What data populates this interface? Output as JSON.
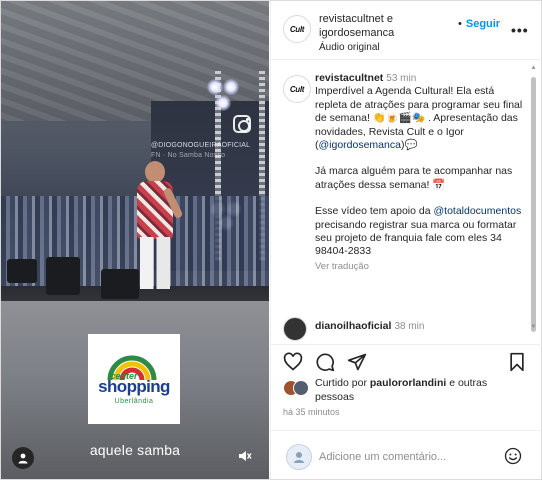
{
  "video": {
    "watermark_line1": "@DIOGONOGUEIRAOFICIAL",
    "watermark_line2": "FN · No Samba Nosso",
    "logo": {
      "center": "center",
      "shopping": "shopping",
      "city": "Uberlândia"
    },
    "caption": "aquele samba"
  },
  "header": {
    "usernames_line1": "revistacultnet e",
    "usernames_line2": "igordosemanca",
    "audio": "Áudio original",
    "follow_separator": "•",
    "follow_label": "Seguir",
    "more": "•••",
    "avatar_text": "Cult"
  },
  "caption_post": {
    "avatar_text": "Cult",
    "username": "revistacultnet",
    "time": "53 min",
    "para1_part1": "Imperdível a Agenda Cultural! Ela está repleta de atrações para programar seu final de semana! 👏🍺🎬🎭 . Apresentação das novidades, Revista Cult e o Igor (",
    "para1_mention": "@igordosemanca",
    "para1_part2": ")💬",
    "para2": "Já marca alguém para te acompanhar nas atrações dessa semana! 📅",
    "para3_part1": "Esse vídeo tem apoio da ",
    "para3_mention": "@totaldocumentos",
    "para3_part2": " precisando registrar sua marca ou formatar seu projeto de franquia fale com eles 34 98404-2833",
    "translate": "Ver tradução"
  },
  "comment2": {
    "username": "dianoilhaoficial",
    "time": "38 min"
  },
  "likes": {
    "prefix": "Curtido por ",
    "user": "paulororlandini",
    "suffix": " e outras pessoas"
  },
  "post_time": "há 35 minutos",
  "add_comment": {
    "placeholder": "Adicione um comentário..."
  }
}
